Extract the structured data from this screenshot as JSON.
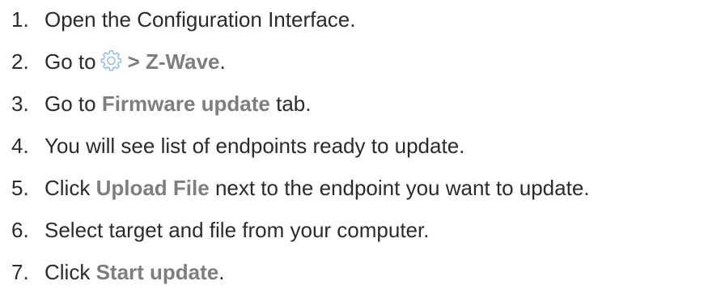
{
  "steps": [
    {
      "number": "1.",
      "text": "Open the Configuration Interface."
    },
    {
      "number": "2.",
      "prefix": "Go to",
      "icon": "gear-icon",
      "separator": ">",
      "highlight": "Z-Wave",
      "suffix": "."
    },
    {
      "number": "3.",
      "prefix": "Go to",
      "highlight": "Firmware update",
      "suffix": "tab."
    },
    {
      "number": "4.",
      "text": "You will see list of endpoints ready to update."
    },
    {
      "number": "5.",
      "prefix": "Click",
      "highlight": "Upload File",
      "suffix": "next to the endpoint you want to update."
    },
    {
      "number": "6.",
      "text": "Select target and file from your computer."
    },
    {
      "number": "7.",
      "prefix": "Click",
      "highlight": "Start update",
      "suffix": "."
    }
  ],
  "colors": {
    "text": "#2b2b2b",
    "highlight": "#7e7e7e",
    "icon": "#8fb7e6"
  }
}
